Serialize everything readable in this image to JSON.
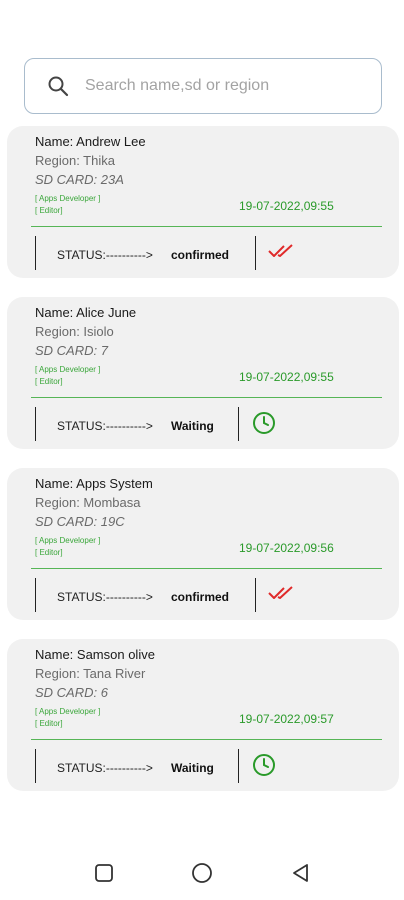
{
  "search": {
    "placeholder": "Search name,sd or region",
    "value": ""
  },
  "cards": [
    {
      "name": "Name: Andrew Lee",
      "region": "Region: Thika",
      "sd_card": "SD CARD: 23A",
      "role_1": "[ Apps Developer ]",
      "role_2": "[ Editor]",
      "timestamp": "19-07-2022,09:55",
      "status_label": "STATUS:---------->",
      "status": "confirmed",
      "status_icon": "double-check-icon"
    },
    {
      "name": "Name: Alice June",
      "region": "Region: Isiolo",
      "sd_card": "SD CARD: 7",
      "role_1": "[ Apps Developer ]",
      "role_2": "[ Editor]",
      "timestamp": "19-07-2022,09:55",
      "status_label": "STATUS:---------->",
      "status": "Waiting",
      "status_icon": "clock-icon"
    },
    {
      "name": "Name: Apps System",
      "region": "Region: Mombasa",
      "sd_card": "SD CARD: 19C",
      "role_1": "[ Apps Developer ]",
      "role_2": "[ Editor]",
      "timestamp": "19-07-2022,09:56",
      "status_label": "STATUS:---------->",
      "status": "confirmed",
      "status_icon": "double-check-icon"
    },
    {
      "name": "Name: Samson olive",
      "region": "Region: Tana River",
      "sd_card": "SD CARD: 6",
      "role_1": "[ Apps Developer ]",
      "role_2": "[ Editor]",
      "timestamp": "19-07-2022,09:57",
      "status_label": "STATUS:---------->",
      "status": "Waiting",
      "status_icon": "clock-icon"
    }
  ],
  "colors": {
    "card_bg": "#f1f1f1",
    "accent_green": "#2a9a2a",
    "confirmed_red": "#e02a2a",
    "search_border": "#a9bccd"
  },
  "navbar": {
    "icons": [
      "recent-apps-icon",
      "home-icon",
      "back-icon"
    ]
  }
}
